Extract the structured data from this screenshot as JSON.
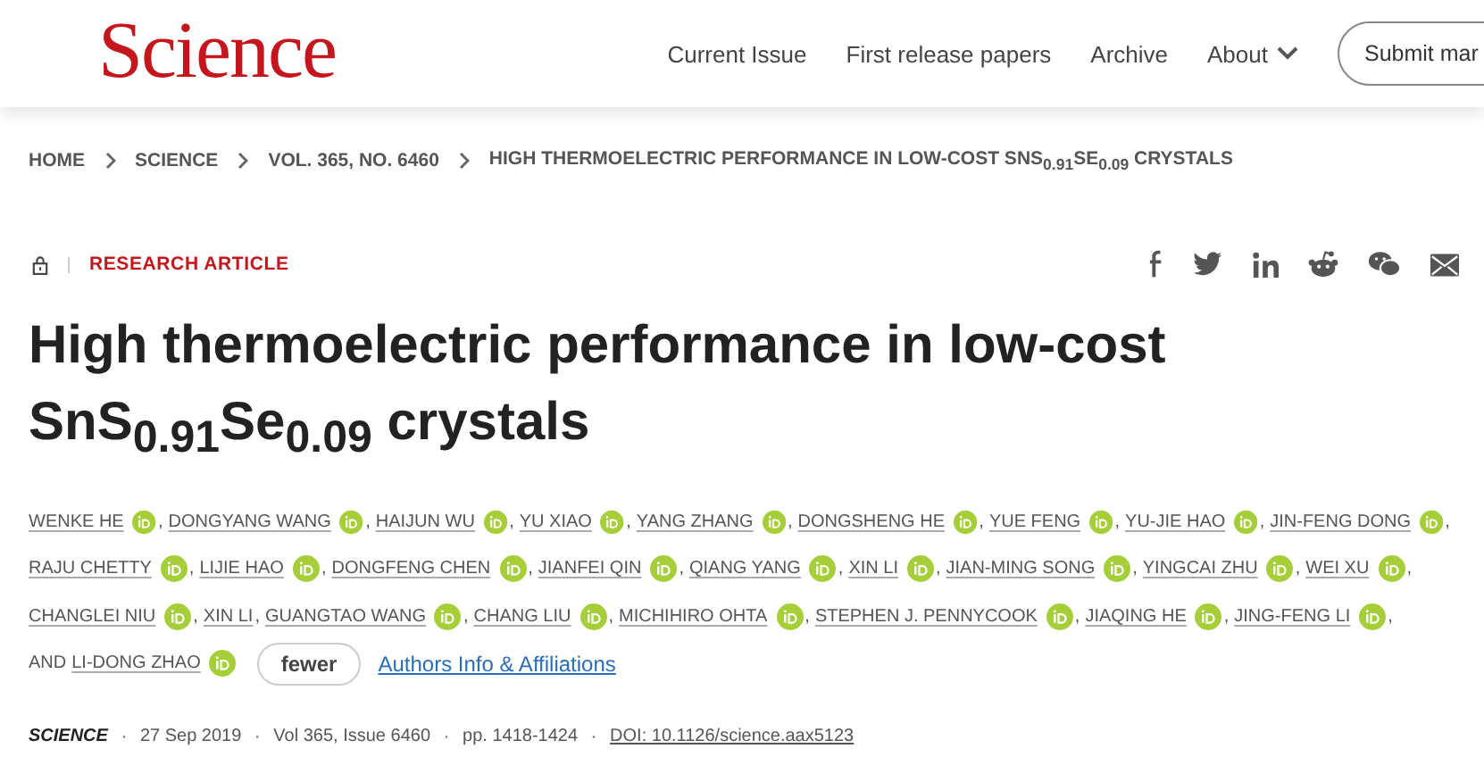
{
  "header": {
    "logo": "Science",
    "nav": [
      {
        "label": "Current Issue",
        "dropdown": false
      },
      {
        "label": "First release papers",
        "dropdown": false
      },
      {
        "label": "Archive",
        "dropdown": false
      },
      {
        "label": "About",
        "dropdown": true
      }
    ],
    "submit_button": "Submit mar"
  },
  "breadcrumb": [
    "HOME",
    "SCIENCE",
    "VOL. 365, NO. 6460",
    "HIGH THERMOELECTRIC PERFORMANCE IN LOW-COST SNS$_{0.91}$SE$_{0.09}$ CRYSTALS"
  ],
  "article": {
    "locked": true,
    "type": "RESEARCH ARTICLE",
    "title": "High thermoelectric performance in low-cost SnS$_{0.91}$Se$_{0.09}$ crystals",
    "author_rows": [
      {
        "prefix": "",
        "authors": [
          {
            "name": "WENKE HE",
            "orcid": true,
            "suffix": ","
          },
          {
            "name": "DONGYANG WANG",
            "orcid": true,
            "suffix": ","
          },
          {
            "name": "HAIJUN WU",
            "orcid": true,
            "suffix": ","
          },
          {
            "name": "YU XIAO",
            "orcid": true,
            "suffix": ","
          },
          {
            "name": "YANG ZHANG",
            "orcid": true,
            "suffix": ","
          },
          {
            "name": "DONGSHENG HE",
            "orcid": true,
            "suffix": ","
          },
          {
            "name": "YUE FENG",
            "orcid": true,
            "suffix": ","
          },
          {
            "name": "YU-JIE HAO",
            "orcid": true,
            "suffix": ","
          },
          {
            "name": "JIN-FENG DONG",
            "orcid": true,
            "suffix": ","
          }
        ]
      },
      {
        "prefix": "",
        "authors": [
          {
            "name": "RAJU CHETTY",
            "orcid": true,
            "suffix": ","
          },
          {
            "name": "LIJIE HAO",
            "orcid": true,
            "suffix": ","
          },
          {
            "name": "DONGFENG CHEN",
            "orcid": true,
            "suffix": ","
          },
          {
            "name": "JIANFEI QIN",
            "orcid": true,
            "suffix": ","
          },
          {
            "name": "QIANG YANG",
            "orcid": true,
            "suffix": ","
          },
          {
            "name": "XIN LI",
            "orcid": true,
            "suffix": ","
          },
          {
            "name": "JIAN-MING SONG",
            "orcid": true,
            "suffix": ","
          },
          {
            "name": "YINGCAI ZHU",
            "orcid": true,
            "suffix": ","
          },
          {
            "name": "WEI XU",
            "orcid": true,
            "suffix": ","
          }
        ]
      },
      {
        "prefix": "",
        "authors": [
          {
            "name": "CHANGLEI NIU",
            "orcid": true,
            "suffix": ","
          },
          {
            "name": "XIN LI",
            "orcid": false,
            "suffix": ","
          },
          {
            "name": "GUANGTAO WANG",
            "orcid": true,
            "suffix": ","
          },
          {
            "name": "CHANG LIU",
            "orcid": true,
            "suffix": ","
          },
          {
            "name": "MICHIHIRO OHTA",
            "orcid": true,
            "suffix": ","
          },
          {
            "name": "STEPHEN J. PENNYCOOK",
            "orcid": true,
            "suffix": ","
          },
          {
            "name": "JIAQING HE",
            "orcid": true,
            "suffix": ","
          },
          {
            "name": "JING-FENG LI",
            "orcid": true,
            "suffix": ","
          }
        ]
      },
      {
        "prefix": "AND",
        "authors": [
          {
            "name": "LI-DONG ZHAO",
            "orcid": true
          }
        ]
      }
    ],
    "fewer_button": "fewer",
    "affiliations_link": "Authors Info & Affiliations",
    "meta": {
      "separator": "·",
      "journal": "SCIENCE",
      "date": "27 Sep 2019",
      "issue": "Vol 365, Issue 6460",
      "pages": "pp. 1418-1424",
      "doi": "DOI: 10.1126/science.aax5123"
    }
  }
}
